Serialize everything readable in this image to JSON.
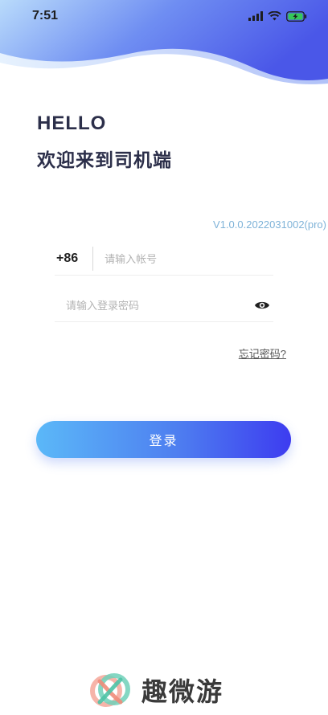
{
  "status_bar": {
    "time": "7:51",
    "battery_state": "charging"
  },
  "greeting": {
    "hello": "HELLO",
    "welcome": "欢迎来到司机端"
  },
  "version": "V1.0.0.2022031002(pro)",
  "account": {
    "country_code": "+86",
    "placeholder": "请输入帐号",
    "value": ""
  },
  "password": {
    "placeholder": "请输入登录密码",
    "value": ""
  },
  "forgot_password": "忘记密码?",
  "login_button": "登录",
  "watermark": {
    "text": "趣微游"
  },
  "colors": {
    "accent_start": "#5bb8f8",
    "accent_end": "#3d3cf0",
    "version_text": "#7fb3d8",
    "heading": "#2c2f4a"
  }
}
